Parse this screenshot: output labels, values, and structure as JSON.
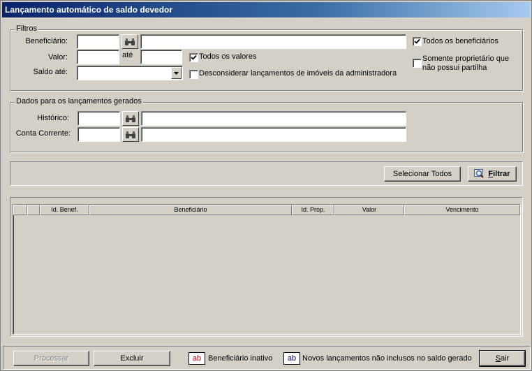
{
  "window": {
    "title": "Lançamento automático de saldo devedor"
  },
  "filtros": {
    "group_title": "Filtros",
    "beneficiario_label": "Beneficiário:",
    "valor_label": "Valor:",
    "ate_label": "até",
    "saldo_label": "Saldo até:",
    "todos_beneficiarios": "Todos os beneficiários",
    "todos_valores": "Todos os valores",
    "somente_proprietario_line1": "Somente proprietário que",
    "somente_proprietario_line2": "não possui partilha",
    "desconsiderar": "Desconsiderar lançamentos de imóveis da administradora",
    "todos_beneficiarios_checked": true,
    "todos_valores_checked": true,
    "somente_proprietario_checked": false,
    "desconsiderar_checked": false
  },
  "dados": {
    "group_title": "Dados para os lançamentos gerados",
    "historico_label": "Histórico:",
    "conta_label": "Conta Corrente:"
  },
  "toolbar": {
    "selecionar_todos": "Selecionar Todos",
    "filtrar_prefix": "F",
    "filtrar_rest": "iltrar"
  },
  "grid": {
    "columns": [
      "",
      "",
      "Id. Benef.",
      "Beneficiário",
      "Id. Prop.",
      "Valor",
      "Vencimento"
    ],
    "rows": []
  },
  "footer": {
    "processar": "Processar",
    "excluir": "Excluir",
    "legend_sample": "ab",
    "beneficiario_inativo": "Beneficiário inativo",
    "novos_lancamentos": "Novos lançamentos não inclusos no saldo gerado",
    "sair_prefix": "S",
    "sair_rest": "air"
  },
  "colors": {
    "title_gradient_start": "#0a246a",
    "inactive_legend_text": "#c00000",
    "new_legend_text": "#000080"
  }
}
